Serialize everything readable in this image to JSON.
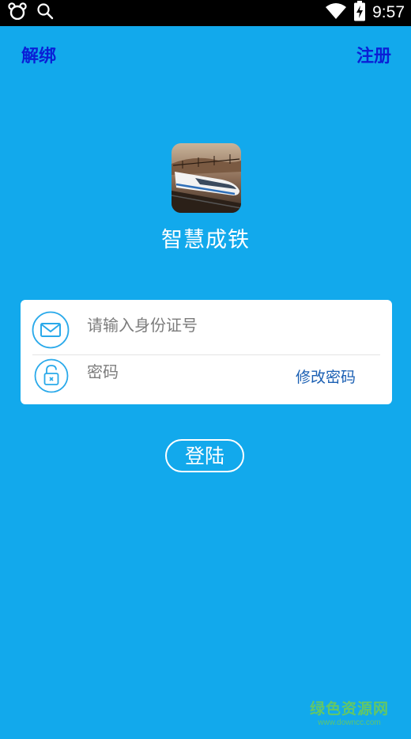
{
  "status_bar": {
    "time": "9:57",
    "icons": [
      "bear-app-icon",
      "search-icon",
      "wifi-icon",
      "battery-charging-icon"
    ]
  },
  "header": {
    "unbind_label": "解绑",
    "register_label": "注册"
  },
  "app": {
    "name": "智慧成铁",
    "logo": "high-speed-train-logo"
  },
  "login_form": {
    "id_placeholder": "请输入身份证号",
    "id_value": "",
    "id_icon": "mail-icon",
    "password_placeholder": "密码",
    "password_value": "",
    "password_icon": "unlock-icon",
    "change_password_label": "修改密码"
  },
  "login_button_label": "登陆",
  "watermark": {
    "title": "绿色资源网",
    "url": "www.downcc.com"
  },
  "colors": {
    "background": "#12a9ec",
    "header_link": "#0a1fd6",
    "icon_accent": "#29a9ea",
    "change_password_link": "#1a5fb3",
    "card": "#ffffff"
  }
}
